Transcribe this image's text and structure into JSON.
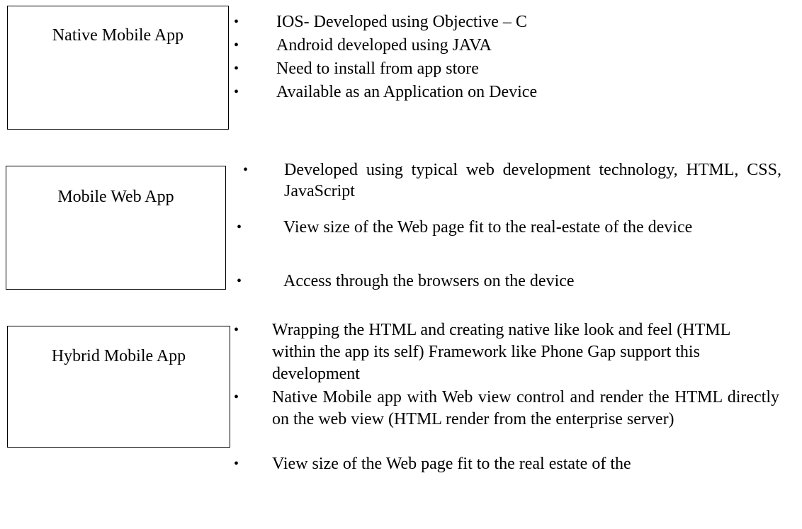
{
  "sections": [
    {
      "box_label": "Native Mobile App",
      "bullets": [
        "IOS- Developed using Objective – C",
        "Android developed using JAVA",
        "Need to install from app store",
        "Available as an Application on Device"
      ]
    },
    {
      "box_label": "Mobile Web App",
      "bullets": [
        "Developed using typical web development technology, HTML, CSS, JavaScript",
        "View size of the Web page fit to the real-estate of the device",
        "Access through the browsers on the device"
      ]
    },
    {
      "box_label": "Hybrid Mobile App",
      "bullets": [
        "Wrapping the HTML and creating native like look and feel (HTML within the app its self) Framework like Phone Gap support this development",
        "Native Mobile app with Web view control and render the HTML directly on the web view (HTML render from the enterprise server)",
        "View size of the Web page fit to the real estate of the"
      ]
    }
  ]
}
